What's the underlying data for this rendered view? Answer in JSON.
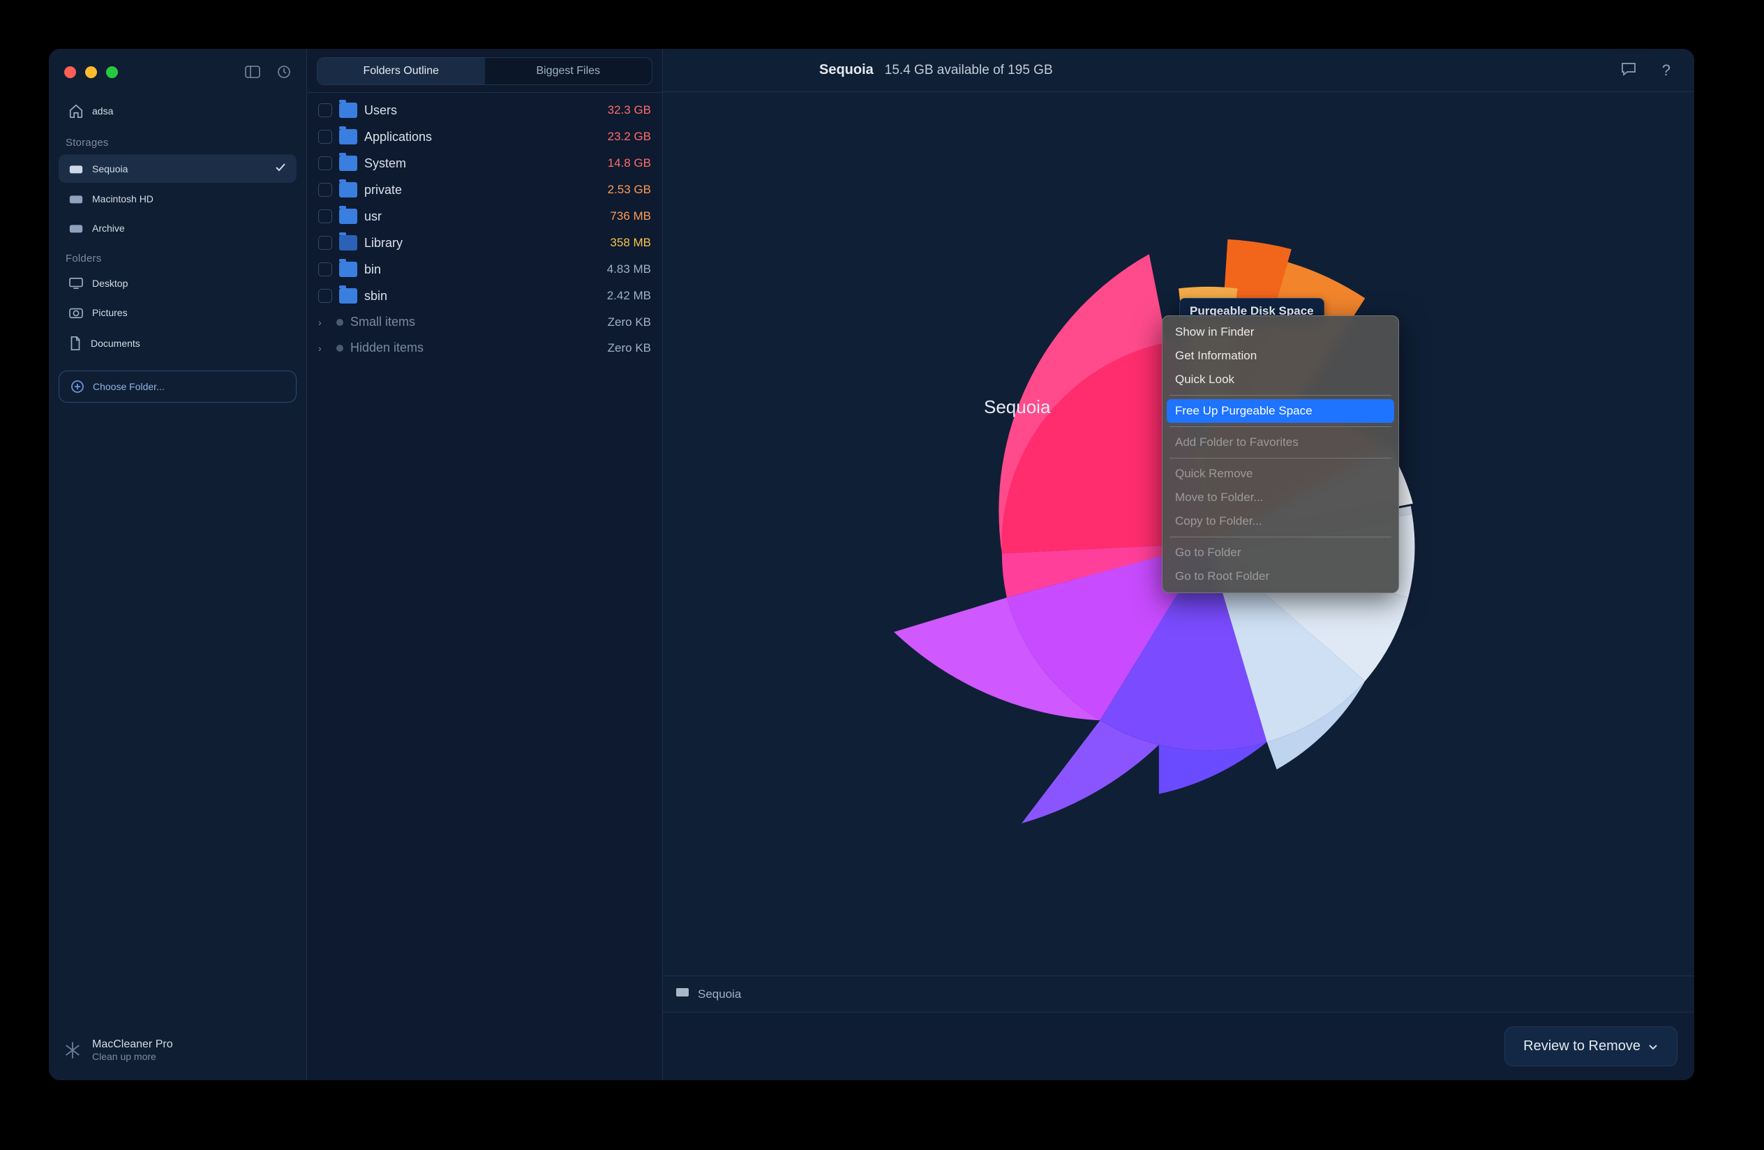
{
  "sidebar": {
    "home_label": "adsa",
    "section_storages": "Storages",
    "storages": [
      {
        "label": "Sequoia",
        "selected": true
      },
      {
        "label": "Macintosh HD",
        "selected": false
      },
      {
        "label": "Archive",
        "selected": false
      }
    ],
    "section_folders": "Folders",
    "folders": [
      {
        "label": "Desktop"
      },
      {
        "label": "Pictures"
      },
      {
        "label": "Documents"
      }
    ],
    "choose_folder": "Choose Folder...",
    "promo_title": "MacCleaner Pro",
    "promo_sub": "Clean up more"
  },
  "tabs": {
    "outline": "Folders Outline",
    "biggest": "Biggest Files"
  },
  "files": [
    {
      "name": "Users",
      "size": "32.3 GB",
      "tone": "red"
    },
    {
      "name": "Applications",
      "size": "23.2 GB",
      "tone": "red"
    },
    {
      "name": "System",
      "size": "14.8 GB",
      "tone": "red"
    },
    {
      "name": "private",
      "size": "2.53 GB",
      "tone": "orange"
    },
    {
      "name": "usr",
      "size": "736 MB",
      "tone": "orange"
    },
    {
      "name": "Library",
      "size": "358 MB",
      "tone": "yellow"
    },
    {
      "name": "bin",
      "size": "4.83 MB",
      "tone": "dim"
    },
    {
      "name": "sbin",
      "size": "2.42 MB",
      "tone": "dim"
    }
  ],
  "meta_rows": [
    {
      "name": "Small items",
      "size": "Zero KB"
    },
    {
      "name": "Hidden items",
      "size": "Zero KB"
    }
  ],
  "header": {
    "volume": "Sequoia",
    "stats": "15.4 GB available of 195 GB"
  },
  "pathbar": {
    "label": "Sequoia"
  },
  "center_label": "Sequoia",
  "tooltip": "Purgeable Disk Space",
  "context_menu": {
    "groups": [
      [
        {
          "label": "Show in Finder",
          "enabled": true
        },
        {
          "label": "Get Information",
          "enabled": true
        },
        {
          "label": "Quick Look",
          "enabled": true
        }
      ],
      [
        {
          "label": "Free Up Purgeable Space",
          "enabled": true,
          "highlight": true
        }
      ],
      [
        {
          "label": "Add Folder to Favorites",
          "enabled": false
        }
      ],
      [
        {
          "label": "Quick Remove",
          "enabled": false
        },
        {
          "label": "Move to Folder...",
          "enabled": false
        },
        {
          "label": "Copy to Folder...",
          "enabled": false
        }
      ],
      [
        {
          "label": "Go to Folder",
          "enabled": false
        },
        {
          "label": "Go to Root Folder",
          "enabled": false
        }
      ]
    ]
  },
  "review_button": "Review to Remove",
  "chart_data": {
    "type": "sunburst",
    "title": "Sequoia disk usage",
    "total_gb": 195,
    "available_gb": 15.4,
    "center_label": "Sequoia",
    "series": [
      {
        "name": "Users",
        "value_gb": 32.3,
        "color": "#ff3e6c"
      },
      {
        "name": "Applications",
        "value_gb": 23.2,
        "color": "#b84bff"
      },
      {
        "name": "System",
        "value_gb": 14.8,
        "color": "#7a4bff"
      },
      {
        "name": "private",
        "value_gb": 2.53,
        "color": "#cfe0f5"
      },
      {
        "name": "usr",
        "value_gb": 0.736,
        "color": "#dfe9f5"
      },
      {
        "name": "Library",
        "value_gb": 0.358,
        "color": "#e8effa"
      },
      {
        "name": "Purgeable",
        "value_gb": 6.0,
        "color": "#dfe7f0"
      },
      {
        "name": "bin",
        "value_gb": 0.00483
      },
      {
        "name": "sbin",
        "value_gb": 0.00242
      },
      {
        "name": "Free",
        "value_gb": 15.4,
        "color": "#ff8a2b"
      }
    ]
  }
}
